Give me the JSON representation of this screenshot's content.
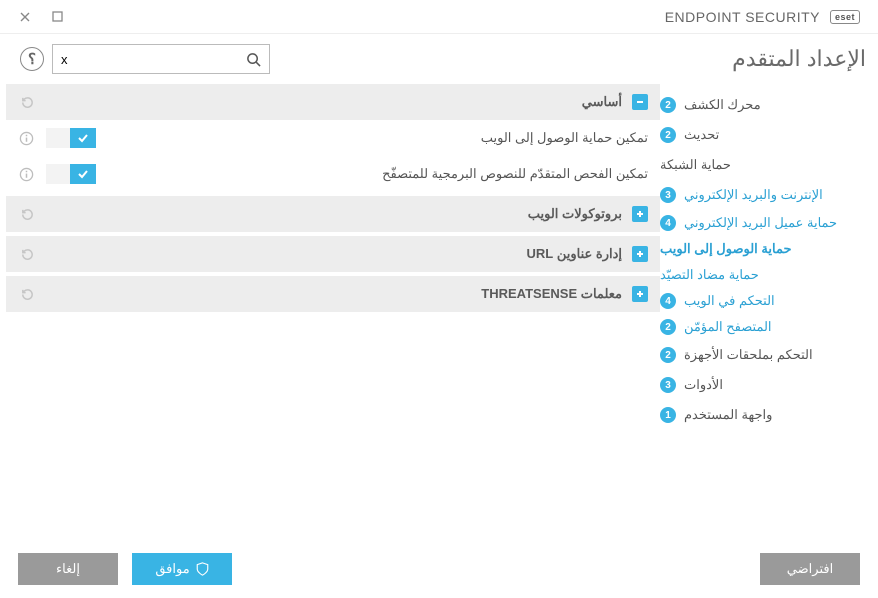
{
  "brand": {
    "badge": "eset",
    "product": "ENDPOINT SECURITY"
  },
  "page_title": "الإعداد المتقدم",
  "search_value": "x",
  "sidebar": {
    "items": [
      {
        "label": "محرك الكشف",
        "count": "2"
      },
      {
        "label": "تحديث",
        "count": "2"
      },
      {
        "label": "حماية الشبكة",
        "count": ""
      },
      {
        "label": "الإنترنت والبريد الإلكتروني",
        "count": "3"
      },
      {
        "label": "التحكم بملحقات الأجهزة",
        "count": "2"
      },
      {
        "label": "الأدوات",
        "count": "3"
      },
      {
        "label": "واجهة المستخدم",
        "count": "1"
      }
    ],
    "sub": [
      {
        "label": "حماية عميل البريد الإلكتروني",
        "count": "4"
      },
      {
        "label": "حماية الوصول إلى الويب",
        "count": ""
      },
      {
        "label": "حماية مضاد التصيّد",
        "count": ""
      },
      {
        "label": "التحكم في الويب",
        "count": "4"
      },
      {
        "label": "المتصفح المؤمّن",
        "count": "2"
      }
    ]
  },
  "sections": {
    "basic": {
      "title": "أساسي",
      "row1": "تمكين حماية الوصول إلى الويب",
      "row2": "تمكين الفحص المتقدّم للنصوص البرمجية للمتصفّح"
    },
    "web_protocols": {
      "title": "بروتوكولات الويب"
    },
    "url_mgmt": {
      "title": "إدارة عناوين URL"
    },
    "threatsense": {
      "title": "معلمات THREATSENSE"
    }
  },
  "footer": {
    "default": "افتراضي",
    "ok": "موافق",
    "cancel": "إلغاء"
  }
}
